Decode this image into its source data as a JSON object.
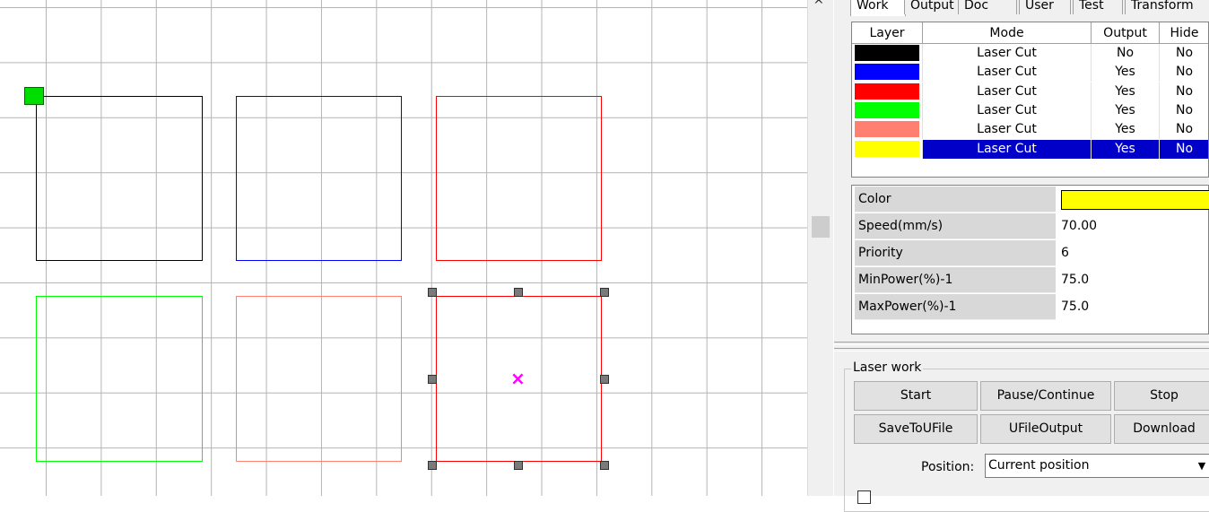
{
  "tabs": [
    {
      "label": "Work",
      "active": true
    },
    {
      "label": "Output"
    },
    {
      "label": "Doc"
    },
    {
      "label": "User"
    },
    {
      "label": "Test"
    },
    {
      "label": "Transform"
    }
  ],
  "layer_table": {
    "headers": [
      "Layer",
      "Mode",
      "Output",
      "Hide"
    ],
    "rows": [
      {
        "color": "#000000",
        "mode": "Laser Cut",
        "output": "No",
        "hide": "No"
      },
      {
        "color": "#0000ff",
        "mode": "Laser Cut",
        "output": "Yes",
        "hide": "No"
      },
      {
        "color": "#ff0000",
        "mode": "Laser Cut",
        "output": "Yes",
        "hide": "No"
      },
      {
        "color": "#00ff00",
        "mode": "Laser Cut",
        "output": "Yes",
        "hide": "No"
      },
      {
        "color": "#ff8070",
        "mode": "Laser Cut",
        "output": "Yes",
        "hide": "No"
      },
      {
        "color": "#ffff00",
        "mode": "Laser Cut",
        "output": "Yes",
        "hide": "No",
        "selected": true
      }
    ]
  },
  "properties": {
    "color_label": "Color",
    "color_value": "#ffff00",
    "speed_label": "Speed(mm/s)",
    "speed_value": "70.00",
    "priority_label": "Priority",
    "priority_value": "6",
    "minpower_label": "MinPower(%)-1",
    "minpower_value": "75.0",
    "maxpower_label": "MaxPower(%)-1",
    "maxpower_value": "75.0"
  },
  "laser_work": {
    "title": "Laser work",
    "start": "Start",
    "pause": "Pause/Continue",
    "stop": "Stop",
    "save_u": "SaveToUFile",
    "ufile_output": "UFileOutput",
    "download": "Download",
    "position_label": "Position:",
    "position_value": "Current position"
  },
  "canvas": {
    "shape_colors": [
      "#000000",
      "#0000ff",
      "#ff0000",
      "#00ff00",
      "#ff8070",
      "#ff0000"
    ],
    "origin_marker_color": "#00dd00",
    "selection_center_color": "#ff00ff",
    "selection_center_glyph": "×"
  }
}
